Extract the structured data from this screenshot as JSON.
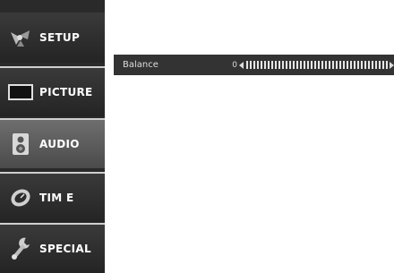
{
  "menu": {
    "items": [
      {
        "label": "SETUP",
        "icon": "satellite-dish-icon",
        "selected": false
      },
      {
        "label": "PICTURE",
        "icon": "screen-icon",
        "selected": false
      },
      {
        "label": "AUDIO",
        "icon": "speaker-icon",
        "selected": true
      },
      {
        "label": "TIM E",
        "icon": "clock-icon",
        "selected": false
      },
      {
        "label": "SPECIAL",
        "icon": "wrench-icon",
        "selected": false
      }
    ]
  },
  "audio_panel": {
    "setting_label": "Balance",
    "value": "0"
  }
}
